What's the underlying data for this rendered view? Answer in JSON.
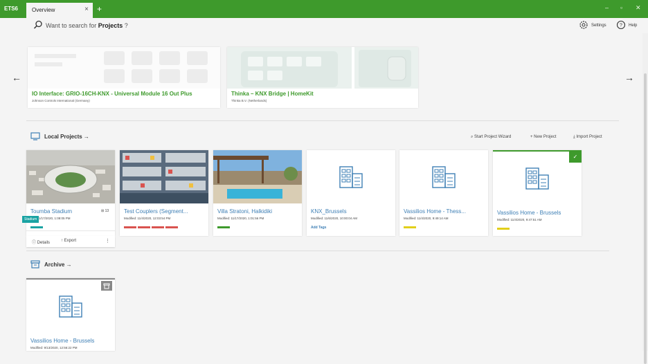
{
  "titlebar": {
    "app": "ETS6",
    "tab": "Overview",
    "tab_close": "×",
    "add_tab": "+",
    "minimize": "–",
    "maximize": "▫",
    "close": "✕",
    "accent": "#3e9a2c"
  },
  "search": {
    "prompt": "Want to search for",
    "keyword": "Projects",
    "suffix": "?"
  },
  "header": {
    "settings": "Settings",
    "help": "Help"
  },
  "nav": {
    "prev": "←",
    "next": "→"
  },
  "banners": [
    {
      "title": "IO Interface:  GRIO-16CH-KNX - Universal Module 16 Out Plus",
      "subtitle": "Johnson Controls International (Germany)"
    },
    {
      "title": "Thinka – KNX Bridge | HomeKit",
      "subtitle": "Thinka B.V. (Netherlands)"
    }
  ],
  "local": {
    "title": "Local Projects →",
    "actions": {
      "wizard": "Start Project Wizard",
      "new": "New Project",
      "import": "Import Project"
    }
  },
  "projects": [
    {
      "title": "Toumba Stadium",
      "modified": "fied: 11/17/2020, 1:08:05 PM",
      "tag": "Stadium",
      "badge": "13",
      "details": "Details",
      "export": "Export",
      "more": "⋮",
      "tag_color": "#1aa3a3"
    },
    {
      "title": "Test Couplers (Segment...",
      "modified": "Modified: 11/4/2020, 12:03:54 PM",
      "tag_colors": [
        "#d9534f",
        "#d9534f",
        "#d9534f",
        "#d9534f"
      ]
    },
    {
      "title": "Villa Stratoni, Halkidiki",
      "modified": "Modified: 11/17/2020, 1:01:56 PM",
      "tag_color": "#3e9a2c"
    },
    {
      "title": "KNX_Brussels",
      "modified": "Modified: 11/6/2020, 10:00:04 AM",
      "add_tags": "Add Tags"
    },
    {
      "title": "Vassilios Home - Thess...",
      "modified": "Modified: 11/4/2020, 9:49:14 AM",
      "tag_color": "#e2cf1a"
    },
    {
      "title": "Vassilios Home - Brussels",
      "modified": "Modified: 11/4/2020, 9:47:51 AM",
      "tag_color": "#e2cf1a",
      "check": "✓"
    }
  ],
  "archive": {
    "title": "Archive →",
    "items": [
      {
        "title": "Vassilios Home - Brussels",
        "modified": "Modified: 9/13/2020, 12:56:22 PM"
      }
    ]
  }
}
